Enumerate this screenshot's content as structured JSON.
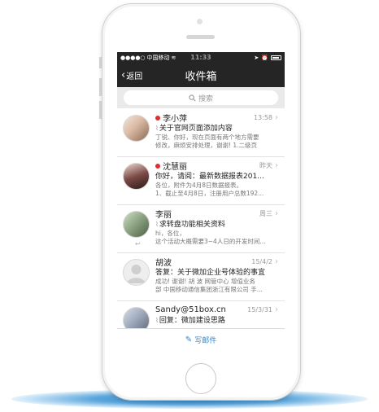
{
  "status": {
    "carrier": "中国移动",
    "time": "11:33"
  },
  "nav": {
    "back_label": "返回",
    "title": "收件箱"
  },
  "search": {
    "placeholder": "搜索"
  },
  "mails": [
    {
      "sender": "李小萍",
      "time": "13:58",
      "subject": "关于官网页面添加内容",
      "preview1": "丁锐、你好，现在页面有两个地方需要",
      "preview2": "修改，麻烦安排处理，谢谢! 1.二级页",
      "unread": true,
      "attachment": true
    },
    {
      "sender": "沈慧丽",
      "time": "昨天",
      "subject": "你好，请阅：最新数据报表201...",
      "preview1": "各位，附件为4月8日数据报表。",
      "preview2": "1、截止至4月8日，注册用户总数192...",
      "unread": true,
      "attachment": false
    },
    {
      "sender": "李丽",
      "time": "周三",
      "subject": "求转盘功能相关资料",
      "preview1": "hi，各位，",
      "preview2": "这个活动大概需要3~4人日的开发时间...",
      "unread": false,
      "attachment": true
    },
    {
      "sender": "胡波",
      "time": "15/4/2",
      "subject": "答复：关于微加企业号体验的事宜",
      "preview1": "成功! 谢谢! 胡 波 网管中心 增值业务",
      "preview2": "部 中国移动通信集团浙江有限公司 手...",
      "unread": false,
      "attachment": false
    },
    {
      "sender": "Sandy@51box.cn",
      "time": "15/3/31",
      "subject": "回复：微加建设思路",
      "preview1": "",
      "preview2": "",
      "unread": false,
      "attachment": true
    }
  ],
  "compose": {
    "label": "写邮件"
  }
}
